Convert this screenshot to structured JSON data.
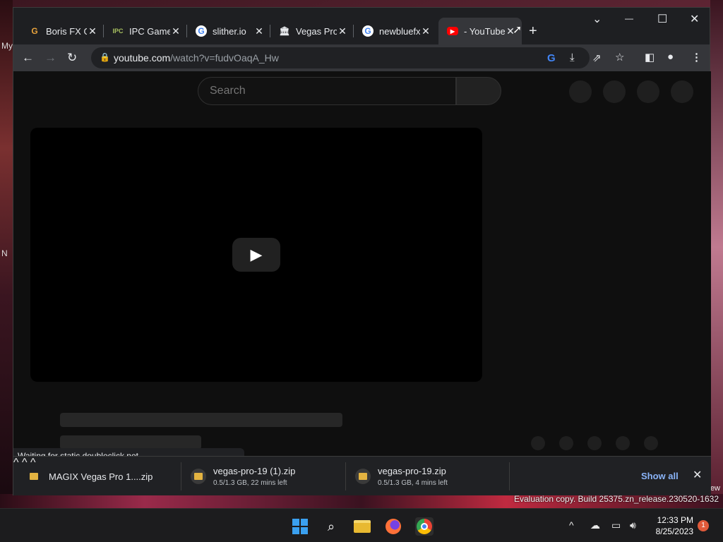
{
  "desktop": {
    "left_labels": [
      "My",
      "N"
    ],
    "eval_text": "Evaluation copy. Build 25375.zn_release.230520-1632",
    "eval_edge": "ew"
  },
  "tabs": [
    {
      "favicon": "G",
      "favicon_color": "#e8a33c",
      "title": "Boris FX G",
      "close": "✕"
    },
    {
      "favicon": "IPC",
      "favicon_color": "#a8c060",
      "title": "IPC Games",
      "close": "✕"
    },
    {
      "favicon": "G",
      "favicon_color": "#4285f4",
      "title": "slither.io",
      "close": "✕"
    },
    {
      "favicon": "🏛",
      "favicon_color": "#e8eaed",
      "title": "Vegas Pro",
      "close": "✕"
    },
    {
      "favicon": "G",
      "favicon_color": "#4285f4",
      "title": "newbluefx",
      "close": "✕"
    },
    {
      "favicon": "▶",
      "favicon_color": "#ff0000",
      "title": "- YouTube",
      "close": "✕"
    }
  ],
  "window_controls": {
    "new_tab": "+",
    "list": "⌄",
    "minimize": "—",
    "maximize": "☐",
    "close": "✕"
  },
  "toolbar": {
    "back": "←",
    "forward": "→",
    "reload": "↻",
    "url_host": "youtube.com",
    "url_path": "/watch?v=fudvOaqA_Hw"
  },
  "youtube": {
    "search_placeholder": "Search",
    "play_icon": "▶"
  },
  "status_text": "Waiting for static.doubleclick.net...",
  "downloads": [
    {
      "name": "MAGIX Vegas Pro 1....zip",
      "sub": ""
    },
    {
      "name": "vegas-pro-19 (1).zip",
      "sub": "0.5/1.3 GB, 22 mins left"
    },
    {
      "name": "vegas-pro-19.zip",
      "sub": "0.5/1.3 GB, 4 mins left"
    }
  ],
  "download_bar": {
    "show_all": "Show all",
    "close": "✕",
    "caret": "^"
  },
  "taskbar": {
    "time": "12:33 PM",
    "date": "8/25/2023",
    "notification_count": "1"
  }
}
